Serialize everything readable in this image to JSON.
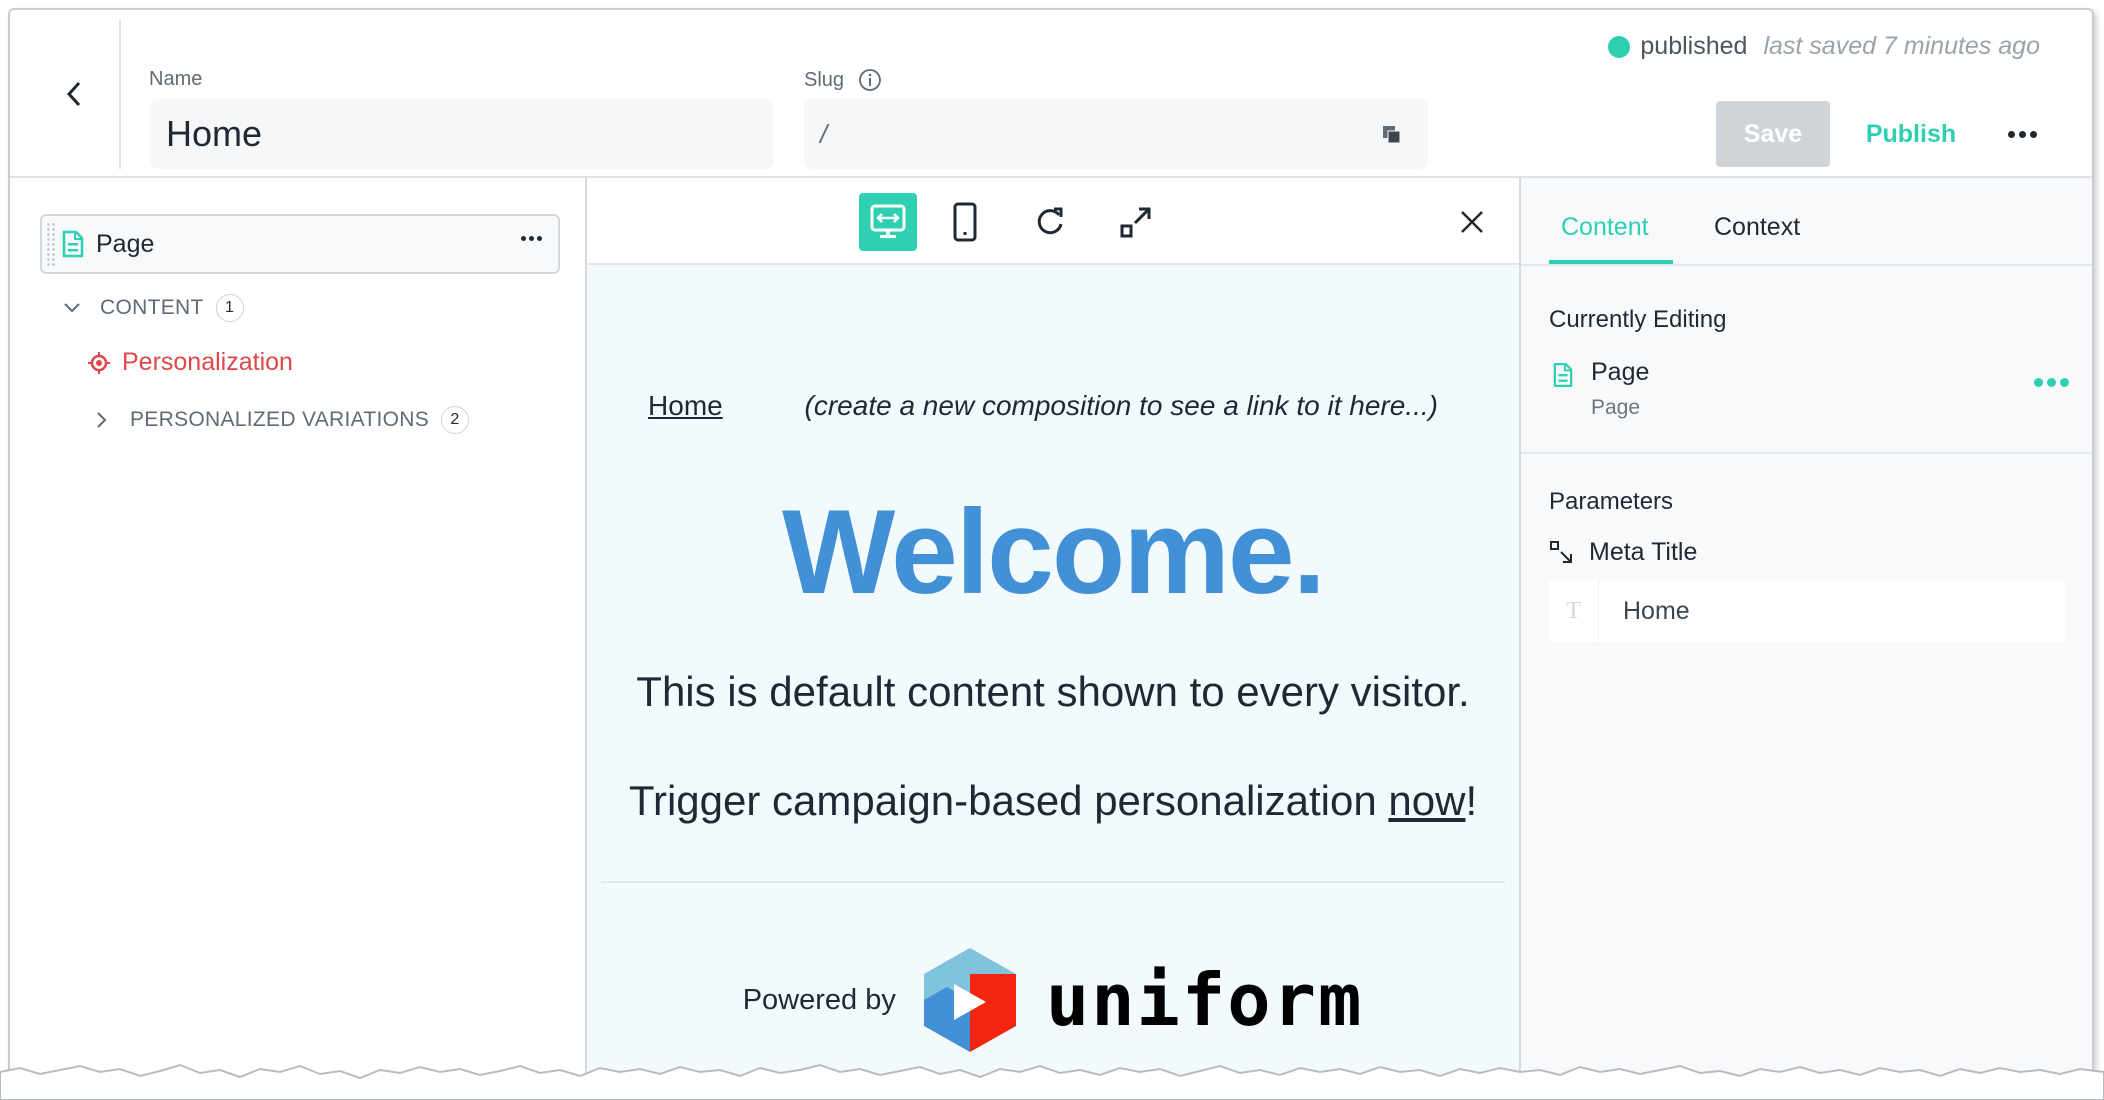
{
  "header": {
    "back_label": "Back",
    "name_label": "Name",
    "name_value": "Home",
    "slug_label": "Slug",
    "slug_value": "/",
    "status": "published",
    "last_saved": "last saved 7 minutes ago",
    "save_label": "Save",
    "publish_label": "Publish",
    "colors": {
      "accent": "#2ecfb3",
      "save_disabled": "#cfd4d8"
    }
  },
  "tree": {
    "root_label": "Page",
    "content_label": "CONTENT",
    "content_count": "1",
    "personalization_label": "Personalization",
    "variations_label": "PERSONALIZED VARIATIONS",
    "variations_count": "2",
    "colors": {
      "personalization": "#e0464a"
    }
  },
  "preview": {
    "toolbar": {
      "desktop": "desktop-icon",
      "mobile": "mobile-icon",
      "refresh": "refresh-icon",
      "expand": "expand-icon",
      "close": "close-icon"
    },
    "nav_home": "Home",
    "nav_hint": "(create a new composition to see a link to it here...)",
    "welcome": "Welcome.",
    "paragraph_1": "This is default content shown to every visitor.",
    "paragraph_2_prefix": "Trigger campaign-based personalization ",
    "paragraph_2_link": "now",
    "paragraph_2_suffix": "!",
    "powered_by": "Powered by",
    "logo_text": "uniform",
    "colors": {
      "welcome": "#4290d6",
      "background": "#f2fafd"
    }
  },
  "right_panel": {
    "tabs": [
      {
        "label": "Content",
        "active": true
      },
      {
        "label": "Context",
        "active": false
      }
    ],
    "currently_editing_title": "Currently Editing",
    "editing_name": "Page",
    "editing_type": "Page",
    "parameters_title": "Parameters",
    "param_name": "Meta Title",
    "param_type_glyph": "T",
    "param_value": "Home"
  }
}
